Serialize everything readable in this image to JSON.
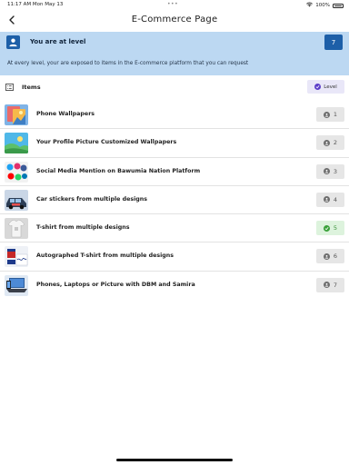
{
  "status_bar": {
    "time": "11:17 AM",
    "date": "Mon May 13",
    "battery": "100%"
  },
  "header": {
    "title": "E-Commerce Page",
    "back_icon": "chevron-left-icon"
  },
  "level_banner": {
    "heading": "You are at level",
    "level": "7",
    "description": "At every level, your are exposed to items in the E-commerce platform that you can request",
    "icon": "user-icon",
    "colors": {
      "background": "#bcd8f2",
      "accent": "#1d5fa8"
    }
  },
  "items_section": {
    "title": "Items",
    "level_chip": "Level",
    "icon": "list-icon"
  },
  "items": [
    {
      "label": "Phone Wallpapers",
      "level": "1",
      "status": "locked"
    },
    {
      "label": "Your Profile Picture Customized Wallpapers",
      "level": "2",
      "status": "locked"
    },
    {
      "label": "Social Media Mention on Bawumia Nation Platform",
      "level": "3",
      "status": "locked"
    },
    {
      "label": "Car stickers from multiple designs",
      "level": "4",
      "status": "locked"
    },
    {
      "label": "T-shirt from multiple designs",
      "level": "5",
      "status": "unlocked"
    },
    {
      "label": "Autographed T-shirt from multiple designs",
      "level": "6",
      "status": "locked"
    },
    {
      "label": "Phones, Laptops or Picture with DBM and Samira",
      "level": "7",
      "status": "locked"
    }
  ]
}
